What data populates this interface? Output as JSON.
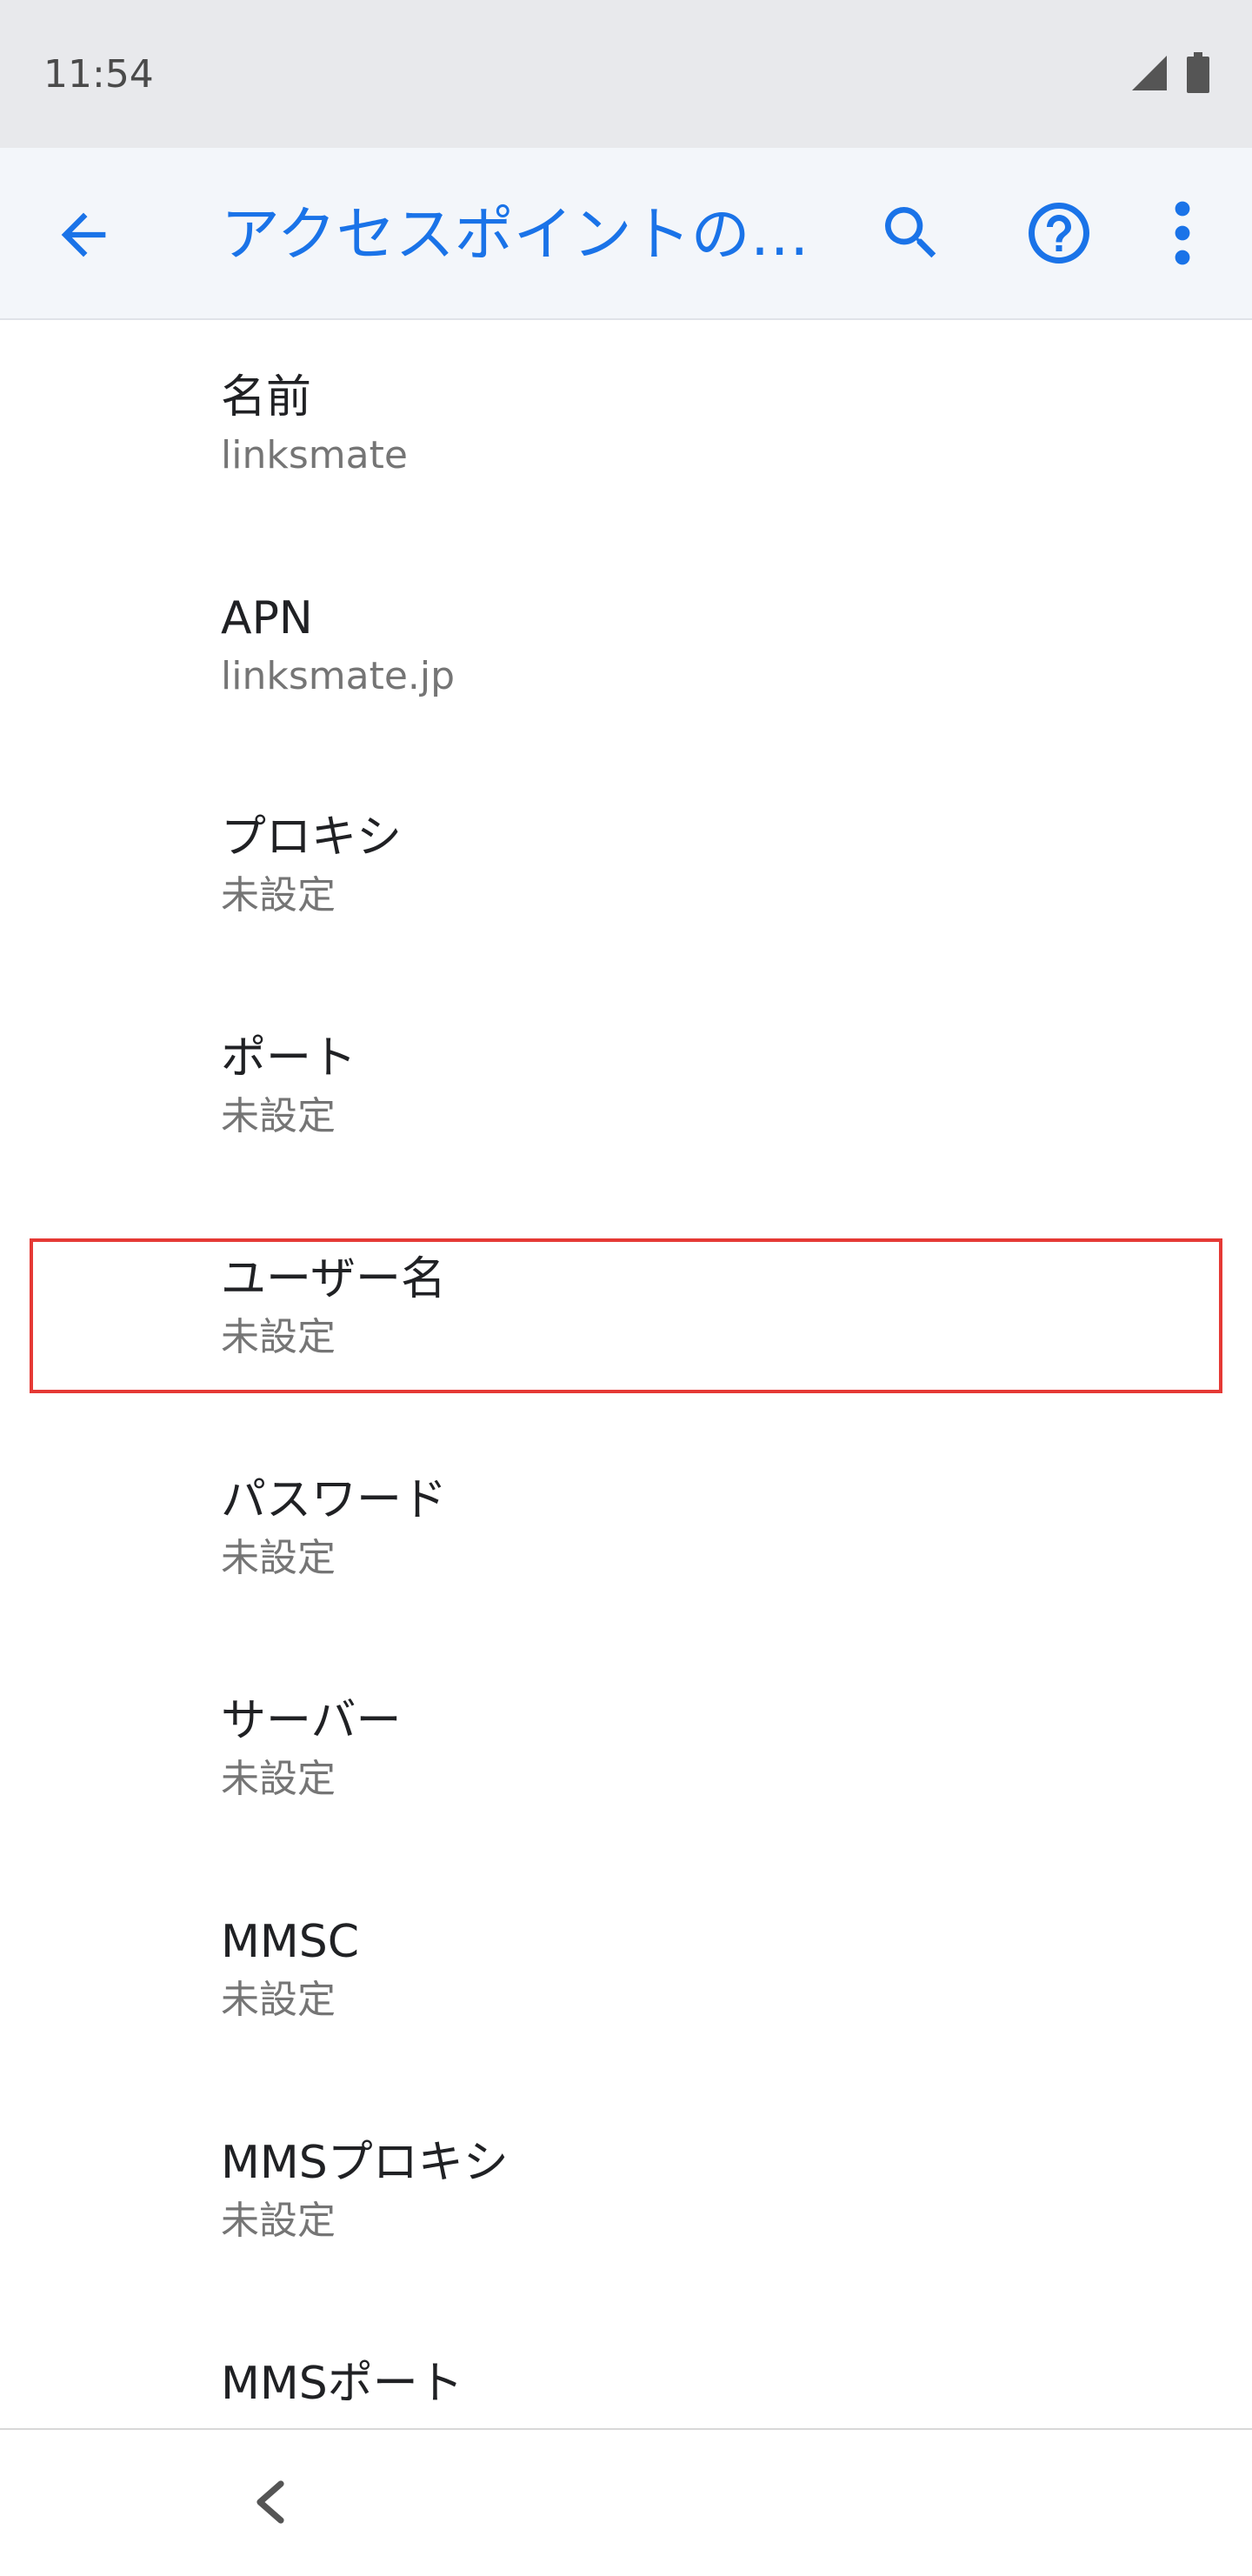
{
  "status_bar": {
    "time": "11:54",
    "icons": [
      "signal-icon",
      "battery-icon"
    ]
  },
  "app_bar": {
    "title": "アクセスポイントの…",
    "icons": [
      "back-arrow-icon",
      "search-icon",
      "help-icon",
      "more-vert-icon"
    ],
    "accent_color": "#1a73e8"
  },
  "list": {
    "items": [
      {
        "title": "名前",
        "summary": "linksmate"
      },
      {
        "title": "APN",
        "summary": "linksmate.jp"
      },
      {
        "title": "プロキシ",
        "summary": "未設定"
      },
      {
        "title": "ポート",
        "summary": "未設定"
      },
      {
        "title": "ユーザー名",
        "summary": "未設定"
      },
      {
        "title": "パスワード",
        "summary": "未設定"
      },
      {
        "title": "サーバー",
        "summary": "未設定"
      },
      {
        "title": "MMSC",
        "summary": "未設定"
      },
      {
        "title": "MMSプロキシ",
        "summary": "未設定"
      },
      {
        "title": "MMSポート",
        "summary": ""
      }
    ]
  },
  "highlight_color": "#e53935",
  "nav_bar": {
    "icons": [
      "nav-back-chevron-icon"
    ]
  }
}
